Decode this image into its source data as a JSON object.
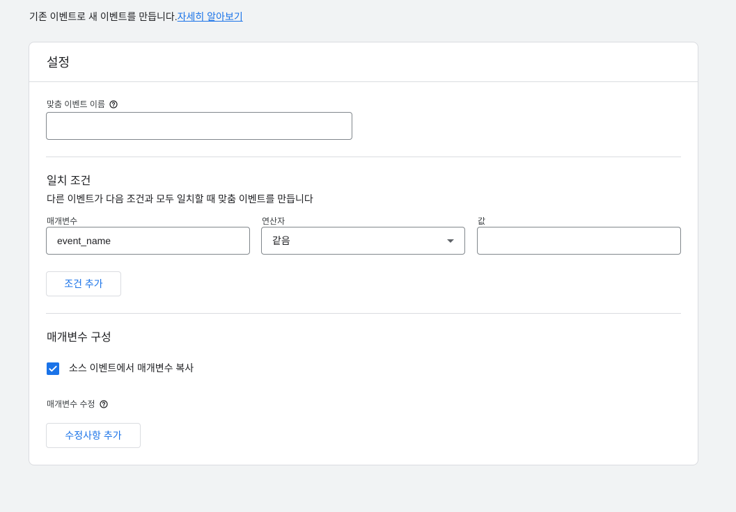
{
  "intro": {
    "text": "기존 이벤트로 새 이벤트를 만듭니다.",
    "link": "자세히 알아보기"
  },
  "card": {
    "title": "설정",
    "custom_event_name": {
      "label": "맞춤 이벤트 이름",
      "value": "",
      "help_icon": "help-circle-icon"
    },
    "matching": {
      "title": "일치 조건",
      "description": "다른 이벤트가 다음 조건과 모두 일치할 때 맞춤 이벤트를 만듭니다",
      "param_label": "매개변수",
      "param_value": "event_name",
      "operator_label": "연산자",
      "operator_value": "같음",
      "value_label": "값",
      "value_value": "",
      "add_condition": "조건 추가"
    },
    "param_config": {
      "title": "매개변수 구성",
      "copy_checkbox_label": "소스 이벤트에서 매개변수 복사",
      "copy_checked": true,
      "modify_label": "매개변수 수정",
      "add_modification": "수정사항 추가"
    }
  },
  "colors": {
    "accent": "#1a73e8",
    "border": "#dadce0",
    "background": "#f1f3f4"
  }
}
